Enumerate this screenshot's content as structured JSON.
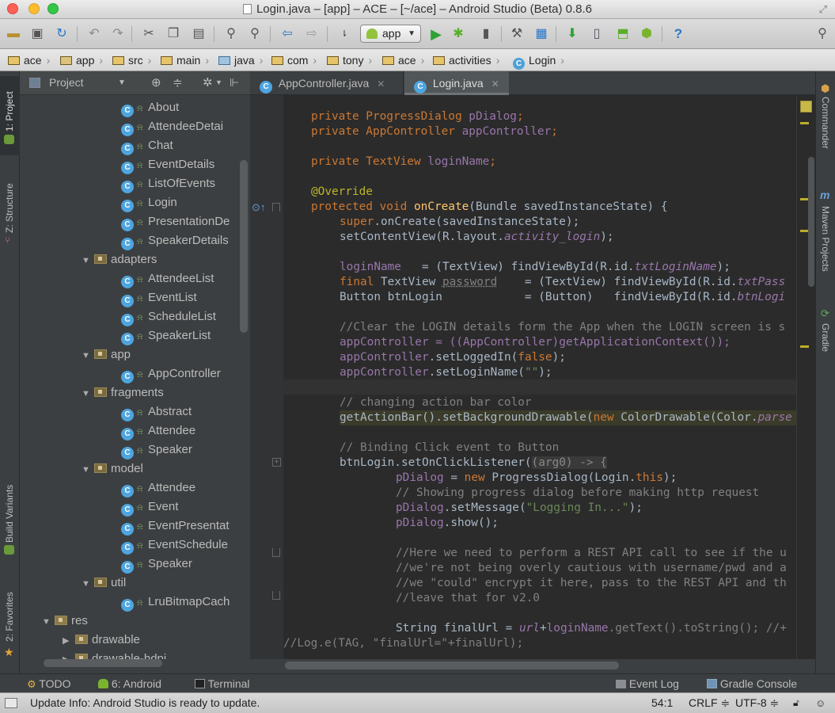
{
  "window": {
    "title": "Login.java – [app] – ACE – [~/ace] – Android Studio (Beta) 0.8.6"
  },
  "toolbar": {
    "run_config": "app",
    "help": "?"
  },
  "breadcrumbs": [
    "ace",
    "app",
    "src",
    "main",
    "java",
    "com",
    "tony",
    "ace",
    "activities",
    "Login"
  ],
  "left_strip": {
    "project": "1: Project",
    "structure": "Z: Structure",
    "build_variants": "Build Variants",
    "favorites": "2: Favorites"
  },
  "right_strip": {
    "commander": "Commander",
    "maven": "Maven Projects",
    "gradle": "Gradle"
  },
  "project_panel": {
    "view": "Project",
    "items": [
      {
        "label": "About",
        "kind": "class"
      },
      {
        "label": "AttendeeDetai",
        "kind": "class"
      },
      {
        "label": "Chat",
        "kind": "class"
      },
      {
        "label": "EventDetails",
        "kind": "class"
      },
      {
        "label": "ListOfEvents",
        "kind": "class"
      },
      {
        "label": "Login",
        "kind": "class"
      },
      {
        "label": "PresentationDe",
        "kind": "class"
      },
      {
        "label": "SpeakerDetails",
        "kind": "class"
      },
      {
        "label": "adapters",
        "kind": "package"
      },
      {
        "label": "AttendeeList",
        "kind": "class"
      },
      {
        "label": "EventList",
        "kind": "class"
      },
      {
        "label": "ScheduleList",
        "kind": "class"
      },
      {
        "label": "SpeakerList",
        "kind": "class"
      },
      {
        "label": "app",
        "kind": "package"
      },
      {
        "label": "AppController",
        "kind": "class"
      },
      {
        "label": "fragments",
        "kind": "package"
      },
      {
        "label": "Abstract",
        "kind": "class"
      },
      {
        "label": "Attendee",
        "kind": "class"
      },
      {
        "label": "Speaker",
        "kind": "class"
      },
      {
        "label": "model",
        "kind": "package"
      },
      {
        "label": "Attendee",
        "kind": "class"
      },
      {
        "label": "Event",
        "kind": "class"
      },
      {
        "label": "EventPresentat",
        "kind": "class"
      },
      {
        "label": "EventSchedule",
        "kind": "class"
      },
      {
        "label": "Speaker",
        "kind": "class"
      },
      {
        "label": "util",
        "kind": "package"
      },
      {
        "label": "LruBitmapCach",
        "kind": "class"
      },
      {
        "label": "res",
        "kind": "res"
      },
      {
        "label": "drawable",
        "kind": "folder"
      },
      {
        "label": "drawable-hdpi",
        "kind": "folder"
      }
    ]
  },
  "editor": {
    "tabs": [
      {
        "label": "AppController.java",
        "active": false
      },
      {
        "label": "Login.java",
        "active": true
      }
    ],
    "code": {
      "l1a": "private ProgressDialog ",
      "l1b": "pDialog",
      "l1c": ";",
      "l2a": "private AppController ",
      "l2b": "appController",
      "l2c": ";",
      "l3a": "private TextView ",
      "l3b": "loginName",
      "l3c": ";",
      "l4": "@Override",
      "l5a": "protected void ",
      "l5b": "onCreate",
      "l5c": "(Bundle savedInstanceState) {",
      "l6a": "super",
      "l6b": ".onCreate(savedInstanceState);",
      "l7a": "setContentView(R.layout.",
      "l7b": "activity_login",
      "l7c": ");",
      "l8a": "loginName",
      "l8b": "   = (TextView) findViewById(R.id.",
      "l8c": "txtLoginName",
      "l8d": ");",
      "l9a": "final ",
      "l9b": "TextView ",
      "l9c": "password",
      "l9d": "    = (TextView) findViewById(R.id.",
      "l9e": "txtPass",
      "l10a": "Button btnLogin            = (Button)   findViewById(R.id.",
      "l10b": "btnLogi",
      "l11": "//Clear the LOGIN details form the App when the LOGIN screen is s",
      "l12": "appController = ((AppController)getApplicationContext());",
      "l13a": "appController",
      "l13b": ".setLoggedIn(",
      "l13c": "false",
      "l13d": ");",
      "l14a": "appController",
      "l14b": ".setLoginName(",
      "l14c": "\"\"",
      "l14d": ");",
      "l15": "// changing action bar color",
      "l16a": "getActionBar().setBackgroundDrawable(",
      "l16b": "new ",
      "l16c": "ColorDrawable(Color.",
      "l16d": "parse",
      "l17": "// Binding Click event to Button",
      "l18a": "btnLogin.setOnClickListener(",
      "l18b": "(arg0) -> {",
      "l19a": "pDialog",
      "l19b": " = ",
      "l19c": "new ",
      "l19d": "ProgressDialog(Login.",
      "l19e": "this",
      "l19f": ");",
      "l20": "// Showing progress dialog before making http request",
      "l21a": "pDialog",
      "l21b": ".setMessage(",
      "l21c": "\"Logging In...\"",
      "l21d": ");",
      "l22a": "pDialog",
      "l22b": ".show();",
      "l23": "//Here we need to perform a REST API call to see if the u",
      "l24": "//we're not being overly cautious with username/pwd and a",
      "l25": "//we \"could\" encrypt it here, pass to the REST API and th",
      "l26": "//leave that for v2.0",
      "l27a": "String finalUrl = ",
      "l27b": "url",
      "l27c": "+",
      "l27d": "loginName",
      "l27e": ".getText().toString(); //+",
      "l28": "//Log.e(TAG, \"finalUrl=\"+finalUrl);"
    }
  },
  "bottom_tools": {
    "todo": "TODO",
    "android": "6: Android",
    "terminal": "Terminal",
    "event_log": "Event Log",
    "gradle_console": "Gradle Console"
  },
  "status": {
    "message": "Update Info: Android Studio is ready to update.",
    "position": "54:1",
    "line_sep": "CRLF ≑",
    "encoding": "UTF-8 ≑"
  },
  "colors": {
    "keyword": "#cc7832",
    "field": "#9876aa",
    "string": "#6a8759",
    "comment": "#808080",
    "annotation": "#bbb529",
    "method": "#ffc66d",
    "editor_bg": "#2b2b2b"
  },
  "icons": [
    "folder-icon",
    "save-icon",
    "sync-icon",
    "undo-icon",
    "redo-icon",
    "cut-icon",
    "copy-icon",
    "paste-icon",
    "find-icon",
    "replace-icon",
    "back-icon",
    "forward-icon",
    "make-icon",
    "android-icon",
    "run-icon",
    "debug-icon",
    "attach-icon",
    "project-structure-icon",
    "sdk-manager-icon",
    "avd-manager-icon",
    "monitor-icon",
    "help-icon",
    "search-icon"
  ]
}
